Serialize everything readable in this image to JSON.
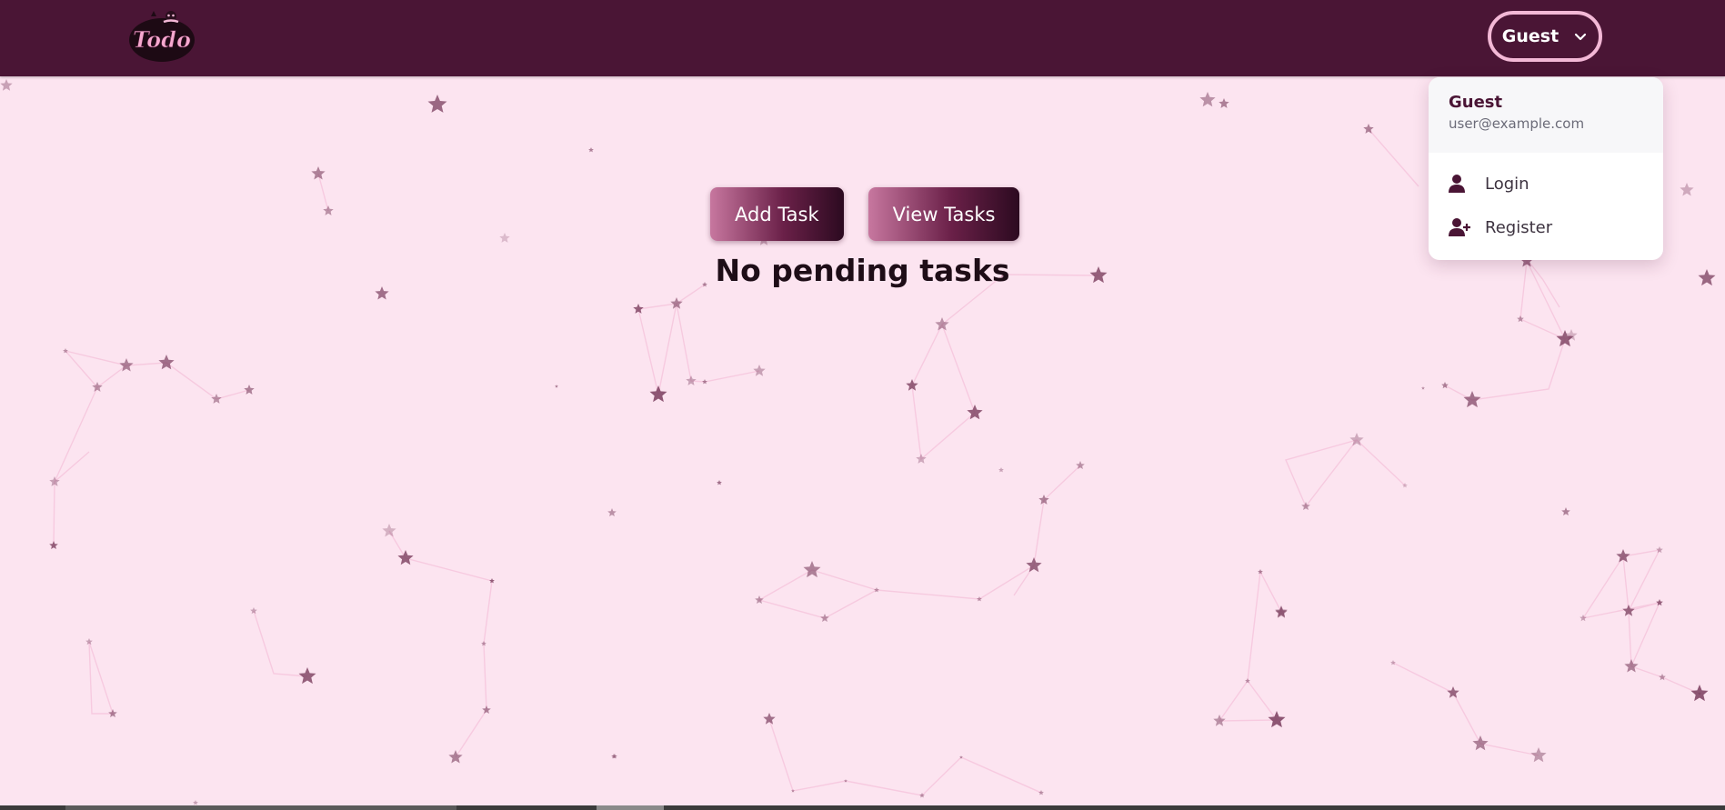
{
  "app": {
    "logo_text": "Todo"
  },
  "header": {
    "user_button_label": "Guest",
    "user_button_icon": "chevron-down-icon"
  },
  "main": {
    "add_task_label": "Add Task",
    "view_tasks_label": "View Tasks",
    "empty_message": "No pending tasks"
  },
  "dropdown": {
    "name": "Guest",
    "email": "user@example.com",
    "items": [
      {
        "label": "Login",
        "icon": "user-icon"
      },
      {
        "label": "Register",
        "icon": "user-plus-icon"
      }
    ]
  },
  "colors": {
    "navbar": "#4a1535",
    "background": "#fce4f0",
    "accent_border": "#f3b8d6",
    "star": "#7a3d5e"
  }
}
